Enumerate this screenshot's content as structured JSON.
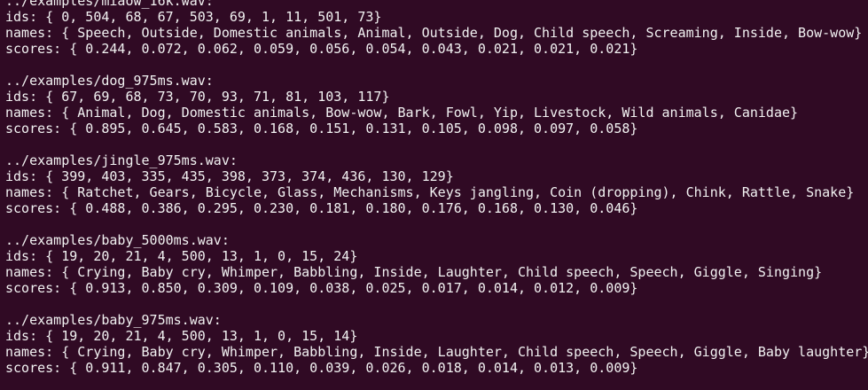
{
  "terminal": {
    "background": "#300a24",
    "foreground": "#f2f2f2",
    "blocks": [
      {
        "path": "../examples/miaow_16k.wav:",
        "ids": "ids: { 0, 504, 68, 67, 503, 69, 1, 11, 501, 73}",
        "names": "names: { Speech, Outside, Domestic animals, Animal, Outside, Dog, Child speech, Screaming, Inside, Bow-wow}",
        "scores": "scores: { 0.244, 0.072, 0.062, 0.059, 0.056, 0.054, 0.043, 0.021, 0.021, 0.021}"
      },
      {
        "path": "../examples/dog_975ms.wav:",
        "ids": "ids: { 67, 69, 68, 73, 70, 93, 71, 81, 103, 117}",
        "names": "names: { Animal, Dog, Domestic animals, Bow-wow, Bark, Fowl, Yip, Livestock, Wild animals, Canidae}",
        "scores": "scores: { 0.895, 0.645, 0.583, 0.168, 0.151, 0.131, 0.105, 0.098, 0.097, 0.058}"
      },
      {
        "path": "../examples/jingle_975ms.wav:",
        "ids": "ids: { 399, 403, 335, 435, 398, 373, 374, 436, 130, 129}",
        "names": "names: { Ratchet, Gears, Bicycle, Glass, Mechanisms, Keys jangling, Coin (dropping), Chink, Rattle, Snake}",
        "scores": "scores: { 0.488, 0.386, 0.295, 0.230, 0.181, 0.180, 0.176, 0.168, 0.130, 0.046}"
      },
      {
        "path": "../examples/baby_5000ms.wav:",
        "ids": "ids: { 19, 20, 21, 4, 500, 13, 1, 0, 15, 24}",
        "names": "names: { Crying, Baby cry, Whimper, Babbling, Inside, Laughter, Child speech, Speech, Giggle, Singing}",
        "scores": "scores: { 0.913, 0.850, 0.309, 0.109, 0.038, 0.025, 0.017, 0.014, 0.012, 0.009}"
      },
      {
        "path": "../examples/baby_975ms.wav:",
        "ids": "ids: { 19, 20, 21, 4, 500, 13, 1, 0, 15, 14}",
        "names": "names: { Crying, Baby cry, Whimper, Babbling, Inside, Laughter, Child speech, Speech, Giggle, Baby laughter}",
        "scores": "scores: { 0.911, 0.847, 0.305, 0.110, 0.039, 0.026, 0.018, 0.014, 0.013, 0.009}"
      }
    ]
  }
}
